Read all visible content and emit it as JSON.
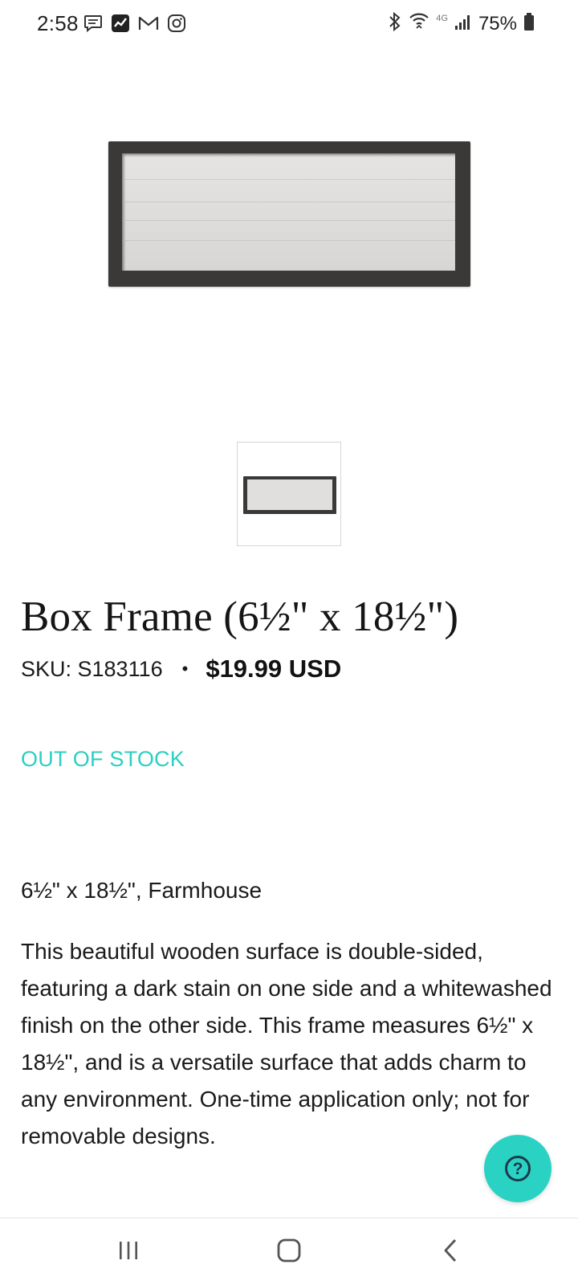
{
  "status_bar": {
    "time": "2:58",
    "left_icons": [
      "message-icon",
      "stocks-app-icon",
      "gmail-icon",
      "instagram-icon"
    ],
    "right_icons": [
      "bluetooth-icon",
      "wifi-icon",
      "lte-icon",
      "signal-icon",
      "battery-icon"
    ],
    "network_label": "4G",
    "battery": "75%"
  },
  "product": {
    "image_icon": "box-frame-image",
    "thumbnail_icon": "box-frame-thumbnail",
    "title": "Box Frame (6½\" x 18½\")",
    "sku": "SKU: S183116",
    "separator": "•",
    "price": "$19.99 USD",
    "stock_status": "OUT OF STOCK",
    "variant": "6½\" x 18½\", Farmhouse",
    "description": "This beautiful wooden surface is double-sided, featuring a dark stain on one side and a whitewashed finish on the other side. This frame measures 6½\" x 18½\", and is a versatile surface that adds charm to any environment. One-time application only; not for removable designs."
  },
  "help_button": {
    "icon": "question-icon",
    "glyph": "?"
  },
  "colors": {
    "accent": "#2ccfc1",
    "frame_dark": "#3b3938",
    "text": "#1a1a1a"
  },
  "nav_bar": {
    "recents_icon": "recents-icon",
    "home_icon": "home-icon",
    "back_icon": "back-icon"
  }
}
